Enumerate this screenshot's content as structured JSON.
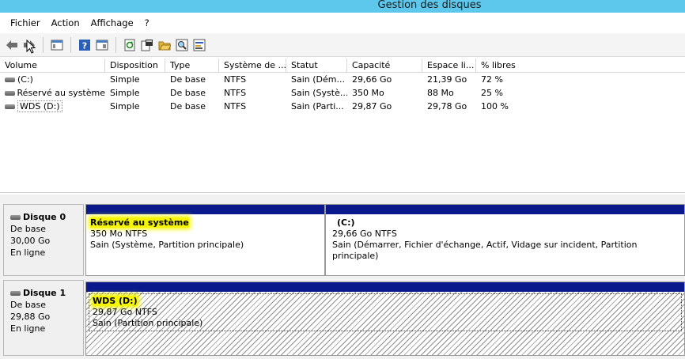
{
  "window": {
    "title": "Gestion des disques"
  },
  "menu": [
    "Fichier",
    "Action",
    "Affichage",
    "?"
  ],
  "toolbar": {
    "buttons": [
      "back-arrow-icon",
      "forward-arrow-icon",
      "console-tree-icon",
      "help-icon",
      "show-hide-icon",
      "refresh-icon",
      "properties-icon",
      "open-folder-icon",
      "search-icon",
      "options-icon"
    ]
  },
  "table": {
    "columns": [
      "Volume",
      "Disposition",
      "Type",
      "Système de ...",
      "Statut",
      "Capacité",
      "Espace li...",
      "% libres"
    ],
    "rows": [
      [
        "(C:)",
        "Simple",
        "De base",
        "NTFS",
        "Sain (Dém...",
        "29,66 Go",
        "21,39 Go",
        "72 %"
      ],
      [
        "Réservé au système",
        "Simple",
        "De base",
        "NTFS",
        "Sain (Systè...",
        "350 Mo",
        "88 Mo",
        "25 %"
      ],
      [
        "WDS (D:)",
        "Simple",
        "De base",
        "NTFS",
        "Sain (Parti...",
        "29,87 Go",
        "29,78 Go",
        "100 %"
      ]
    ]
  },
  "disks": [
    {
      "name": "Disque 0",
      "type": "De base",
      "size": "30,00 Go",
      "state": "En ligne",
      "partitions": [
        {
          "name": "Réservé au système",
          "size": "350 Mo NTFS",
          "status": "Sain (Système, Partition principale)"
        },
        {
          "name": "(C:)",
          "size": "29,66 Go NTFS",
          "status": "Sain (Démarrer, Fichier d'échange, Actif, Vidage sur incident, Partition principale)"
        }
      ]
    },
    {
      "name": "Disque 1",
      "type": "De base",
      "size": "29,88 Go",
      "state": "En ligne",
      "partitions": [
        {
          "name": "WDS  (D:)",
          "size": "29,87 Go NTFS",
          "status": "Sain (Partition principale)"
        }
      ]
    }
  ]
}
